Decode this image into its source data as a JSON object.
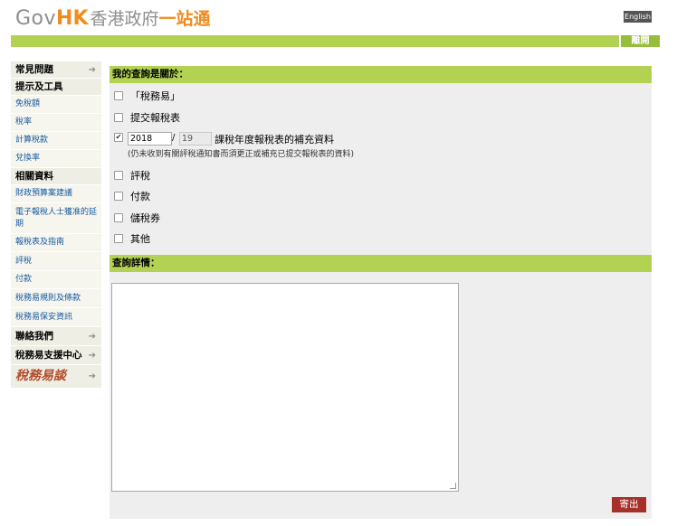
{
  "header": {
    "logo_gov": "Gov",
    "logo_hk": "HK",
    "logo_zh1": "香港政府",
    "logo_zh2": "一站通",
    "lang_button": "English",
    "leave_button": "離開"
  },
  "sidebar": {
    "items": [
      {
        "label": "常見問題",
        "type": "head",
        "arrow": "➔"
      },
      {
        "label": "提示及工具",
        "type": "head",
        "arrow": ""
      },
      {
        "label": "免稅額",
        "type": "sub",
        "arrow": ""
      },
      {
        "label": "稅率",
        "type": "sub",
        "arrow": ""
      },
      {
        "label": "計算稅款",
        "type": "sub",
        "arrow": ""
      },
      {
        "label": "兌換率",
        "type": "sub",
        "arrow": ""
      },
      {
        "label": "相關資料",
        "type": "head",
        "arrow": ""
      },
      {
        "label": "財政預算案建議",
        "type": "sub",
        "arrow": ""
      },
      {
        "label": "電子報稅人士獲准的延期",
        "type": "sub",
        "arrow": ""
      },
      {
        "label": "報稅表及指南",
        "type": "sub",
        "arrow": ""
      },
      {
        "label": "評稅",
        "type": "sub",
        "arrow": ""
      },
      {
        "label": "付款",
        "type": "sub",
        "arrow": ""
      },
      {
        "label": "稅務易規則及條款",
        "type": "sub",
        "arrow": ""
      },
      {
        "label": "稅務易保安資訊",
        "type": "sub",
        "arrow": ""
      },
      {
        "label": "聯絡我們",
        "type": "head",
        "arrow": "➔"
      },
      {
        "label": "稅務易支援中心",
        "type": "head",
        "arrow": "➔"
      },
      {
        "label": "稅務易談",
        "type": "logo",
        "arrow": "➔"
      }
    ]
  },
  "enquiry": {
    "section_title": "我的查詢是關於：",
    "options": [
      {
        "label": "「稅務易」",
        "checked": false
      },
      {
        "label": "提交報稅表",
        "checked": false
      },
      {
        "label": "",
        "checked": true
      },
      {
        "label": "評稅",
        "checked": false
      },
      {
        "label": "付款",
        "checked": false
      },
      {
        "label": "儲稅券",
        "checked": false
      },
      {
        "label": "其他",
        "checked": false
      }
    ],
    "year_from": "2018",
    "year_to": "19",
    "year_label": "課稅年度報稅表的補充資料",
    "year_note": "(仍未收到有關評稅通知書而須更正或補充已提交報稅表的資料)"
  },
  "details": {
    "section_title": "查詢詳情：",
    "textarea_value": ""
  },
  "actions": {
    "send_button": "寄出"
  },
  "colors": {
    "green_bar": "#b3d254",
    "sidebar_bg": "#eeeee4",
    "send_button": "#a8302a",
    "logo_orange": "#f08c1e"
  }
}
